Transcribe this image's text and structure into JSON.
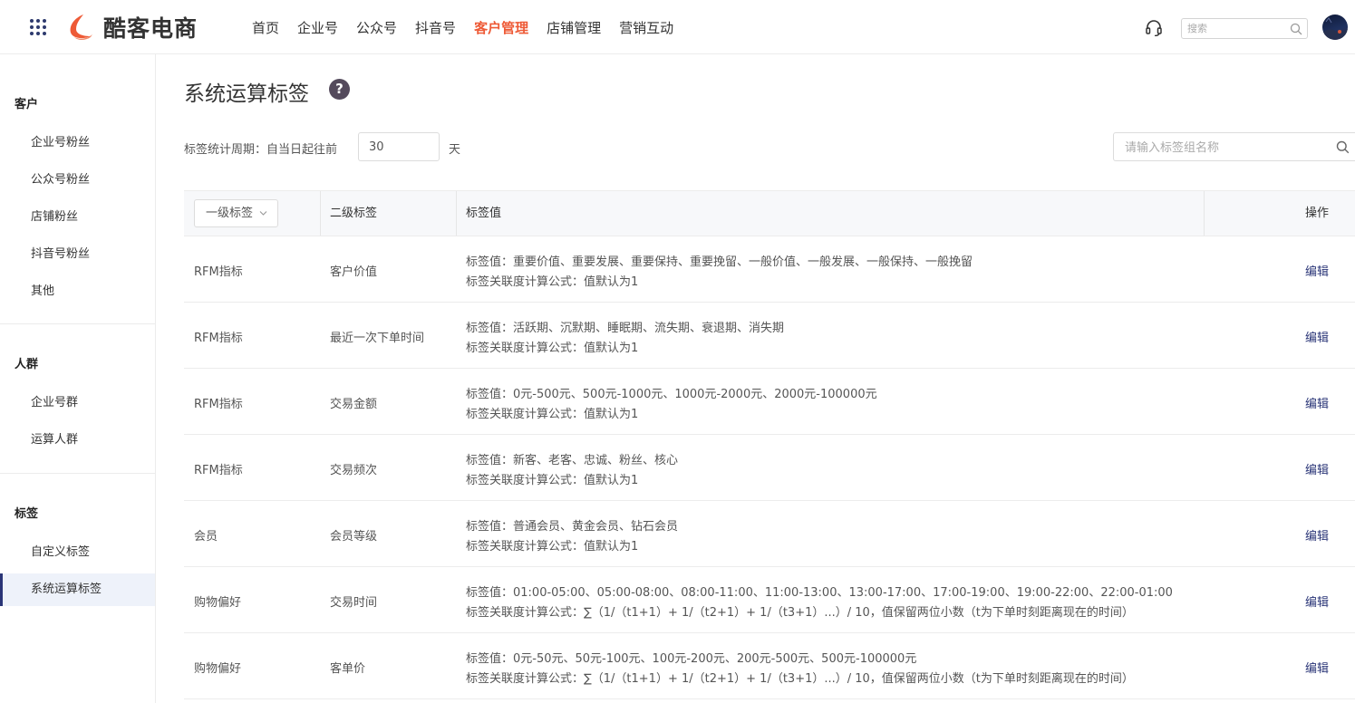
{
  "header": {
    "logo_text": "酷客电商",
    "nav": [
      "首页",
      "企业号",
      "公众号",
      "抖音号",
      "客户管理",
      "店铺管理",
      "营销互动"
    ],
    "active_nav_index": 4,
    "search_placeholder": "搜索",
    "accent_color": "#ee5a36"
  },
  "sidebar": {
    "sections": [
      {
        "title": "客户",
        "items": [
          "企业号粉丝",
          "公众号粉丝",
          "店铺粉丝",
          "抖音号粉丝",
          "其他"
        ]
      },
      {
        "title": "人群",
        "items": [
          "企业号群",
          "运算人群"
        ]
      },
      {
        "title": "标签",
        "items": [
          "自定义标签",
          "系统运算标签"
        ]
      }
    ],
    "active_item": "系统运算标签"
  },
  "main": {
    "title": "系统运算标签",
    "help_symbol": "?",
    "period_label": "标签统计周期：自当日起往前",
    "period_value": "30",
    "period_unit": "天",
    "group_search_placeholder": "请输入标签组名称"
  },
  "table": {
    "level1_select": "一级标签",
    "columns": {
      "level2": "二级标签",
      "values": "标签值",
      "action": "操作"
    },
    "rows": [
      {
        "level1": "RFM指标",
        "level2": "客户价值",
        "values": "标签值：重要价值、重要发展、重要保持、重要挽留、一般价值、一般发展、一般保持、一般挽留",
        "formula": "标签关联度计算公式：值默认为1",
        "action": "编辑"
      },
      {
        "level1": "RFM指标",
        "level2": "最近一次下单时间",
        "values": "标签值：活跃期、沉默期、睡眠期、流失期、衰退期、消失期",
        "formula": "标签关联度计算公式：值默认为1",
        "action": "编辑"
      },
      {
        "level1": "RFM指标",
        "level2": "交易金额",
        "values": "标签值：0元-500元、500元-1000元、1000元-2000元、2000元-100000元",
        "formula": "标签关联度计算公式：值默认为1",
        "action": "编辑"
      },
      {
        "level1": "RFM指标",
        "level2": "交易频次",
        "values": "标签值：新客、老客、忠诚、粉丝、核心",
        "formula": "标签关联度计算公式：值默认为1",
        "action": "编辑"
      },
      {
        "level1": "会员",
        "level2": "会员等级",
        "values": "标签值：普通会员、黄金会员、钻石会员",
        "formula": "标签关联度计算公式：值默认为1",
        "action": "编辑"
      },
      {
        "level1": "购物偏好",
        "level2": "交易时间",
        "values": "标签值：01:00-05:00、05:00-08:00、08:00-11:00、11:00-13:00、13:00-17:00、17:00-19:00、19:00-22:00、22:00-01:00",
        "formula": "标签关联度计算公式：∑（1/（t1+1）+ 1/（t2+1）+ 1/（t3+1）...）/ 10，值保留两位小数（t为下单时刻距离现在的时间）",
        "action": "编辑"
      },
      {
        "level1": "购物偏好",
        "level2": "客单价",
        "values": "标签值：0元-50元、50元-100元、100元-200元、200元-500元、500元-100000元",
        "formula": "标签关联度计算公式：∑（1/（t1+1）+ 1/（t2+1）+ 1/（t3+1）...）/ 10，值保留两位小数（t为下单时刻距离现在的时间）",
        "action": "编辑"
      }
    ]
  }
}
